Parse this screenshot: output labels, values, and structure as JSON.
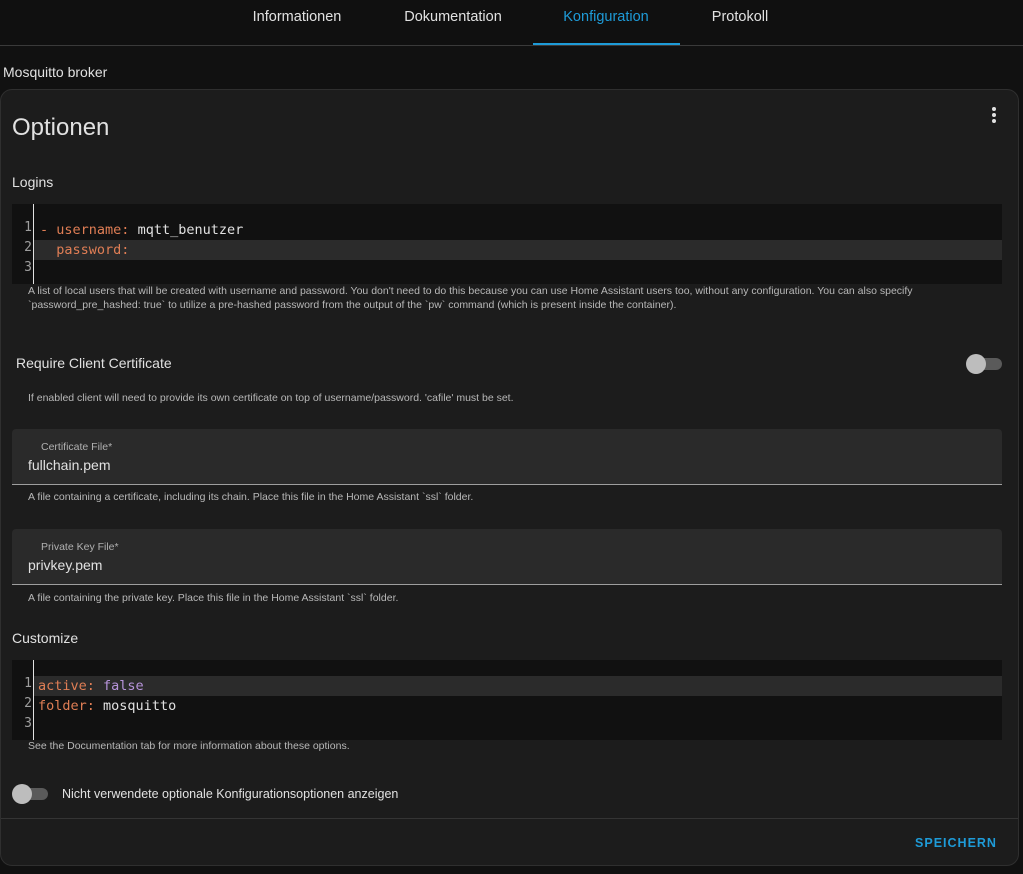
{
  "tabs": [
    {
      "label": "Informationen"
    },
    {
      "label": "Dokumentation"
    },
    {
      "label": "Konfiguration",
      "active": true
    },
    {
      "label": "Protokoll"
    }
  ],
  "addon_name": "Mosquitto broker",
  "card": {
    "title": "Optionen",
    "menu_icon": "dots-vertical-icon"
  },
  "logins": {
    "label": "Logins",
    "lines": [
      {
        "n": "1",
        "dash": "- ",
        "key": "username",
        "sep": ": ",
        "val": "mqtt_benutzer"
      },
      {
        "n": "2",
        "indent": "  ",
        "key": "password",
        "sep": ":",
        "val": ""
      },
      {
        "n": "3"
      }
    ],
    "help_line1": "A list of local users that will be created with username and password. You don't need to do this because you can use Home Assistant users too, without any configuration. You can also specify",
    "help_line2": "`password_pre_hashed: true` to utilize a pre-hashed password from the output of the `pw` command (which is present inside the container)."
  },
  "require_cert": {
    "label": "Require Client Certificate",
    "enabled": false,
    "help": "If enabled client will need to provide its own certificate on top of username/password. 'cafile' must be set."
  },
  "certfile": {
    "label": "Certificate File*",
    "value": "fullchain.pem",
    "help": "A file containing a certificate, including its chain. Place this file in the Home Assistant `ssl` folder."
  },
  "keyfile": {
    "label": "Private Key File*",
    "value": "privkey.pem",
    "help": "A file containing the private key. Place this file in the Home Assistant `ssl` folder."
  },
  "customize": {
    "label": "Customize",
    "lines": [
      {
        "n": "1",
        "key": "active",
        "sep": ": ",
        "val": "false"
      },
      {
        "n": "2",
        "key": "folder",
        "sep": ": ",
        "val": "mosquitto"
      },
      {
        "n": "3"
      }
    ],
    "help": "See the Documentation tab for more information about these options."
  },
  "show_unused": {
    "label": "Nicht verwendete optionale Konfigurationsoptionen anzeigen",
    "enabled": false
  },
  "save_label": "SPEICHERN",
  "colors": {
    "accent": "#1e9bd8",
    "yaml_key": "#e07e55",
    "yaml_bool": "#b794db",
    "card_bg": "#1c1c1c"
  }
}
